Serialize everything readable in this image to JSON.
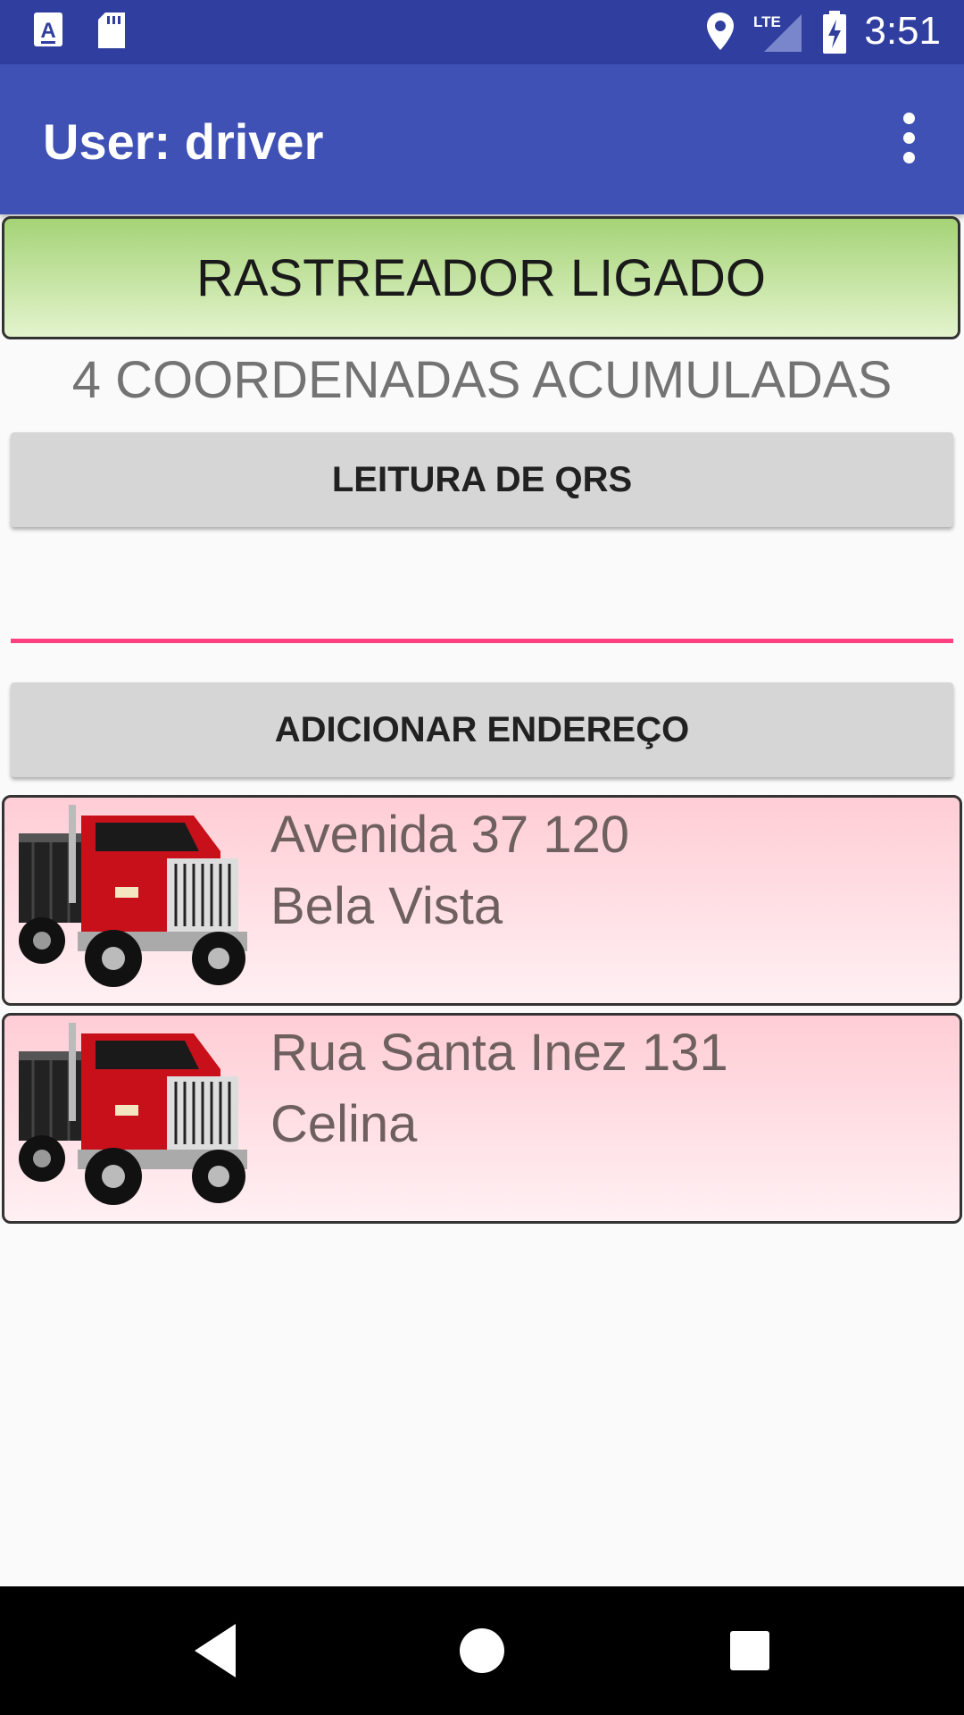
{
  "status_bar": {
    "time": "3:51",
    "network": "LTE",
    "icons": [
      "a-notification-icon",
      "sd-card-icon",
      "location-icon",
      "lte-signal-icon",
      "battery-charging-icon"
    ]
  },
  "app_bar": {
    "title": "User: driver",
    "menu_icon": "more-vert-icon"
  },
  "tracker": {
    "status_label": "RASTREADOR LIGADO",
    "color_top": "#a5d376",
    "color_bottom": "#e3f4cd"
  },
  "coordinates_label": "4 COORDENADAS ACUMULADAS",
  "buttons": {
    "qr_label": "LEITURA DE QRS",
    "add_address_label": "ADICIONAR ENDEREÇO"
  },
  "address_input": {
    "value": "",
    "accent_color": "#ff4081"
  },
  "addresses": [
    {
      "street": "Avenida 37 120",
      "neighborhood": "Bela Vista",
      "icon": "truck-icon"
    },
    {
      "street": "Rua Santa Inez 131",
      "neighborhood": "Celina",
      "icon": "truck-icon"
    }
  ],
  "nav_bar": {
    "icons": [
      "back-icon",
      "home-icon",
      "recents-icon"
    ]
  }
}
